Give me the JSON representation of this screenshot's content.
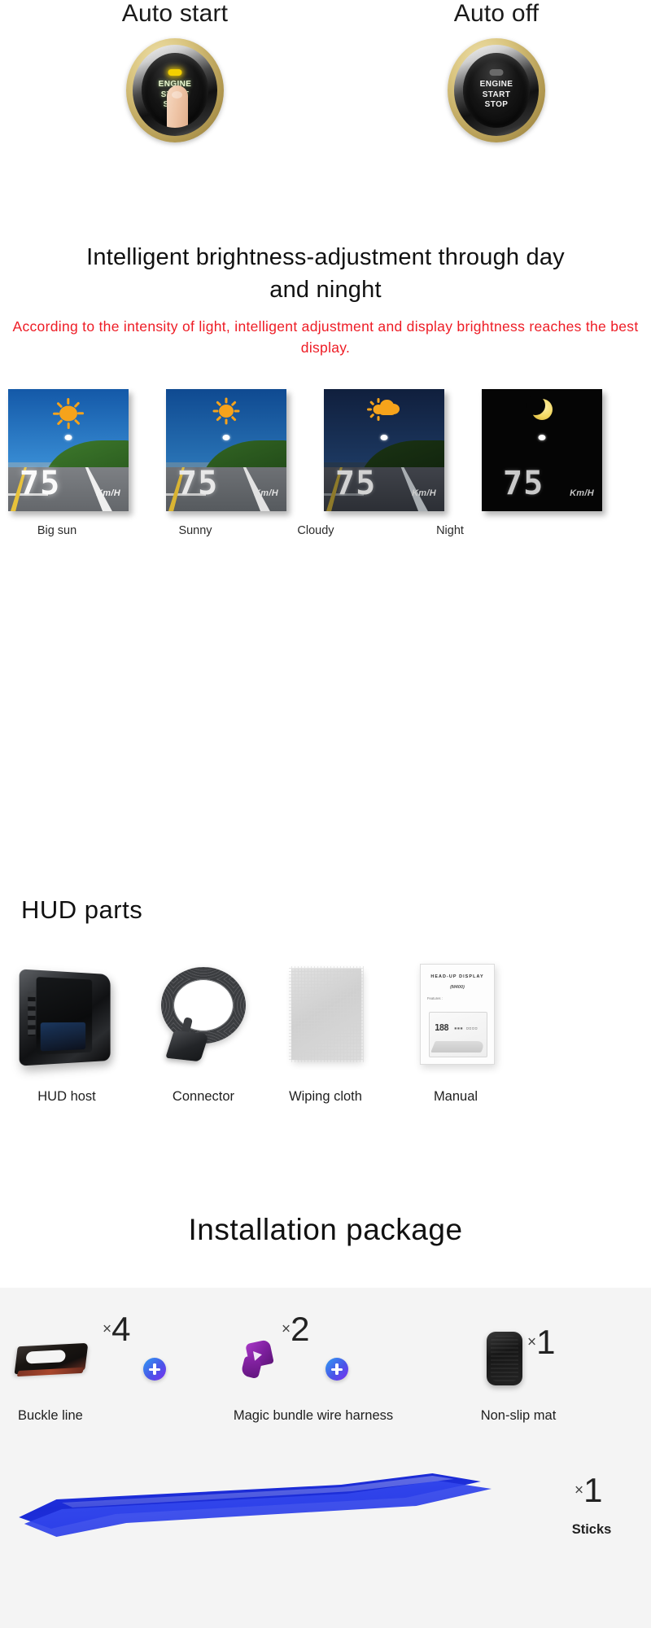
{
  "engine_section": {
    "buttons": [
      {
        "title": "Auto start",
        "button_text": "ENGINE\nSTART\nSTOP",
        "line1": "ENGINE",
        "line2": "START",
        "line3": "STOP",
        "led": "on",
        "led_color": "#f4d000",
        "has_finger": true
      },
      {
        "title": "Auto off",
        "button_text": "ENGINE\nSTART\nSTOP",
        "line1": "ENGINE",
        "line2": "START",
        "line3": "STOP",
        "led": "off",
        "led_color": "#6a6a6a",
        "has_finger": false
      }
    ]
  },
  "brightness_section": {
    "heading": "Intelligent brightness-adjustment through day and ninght",
    "subheading": "According to the intensity of light, intelligent adjustment and display brightness reaches the best display.",
    "subheading_color": "#ee1c25",
    "panels": [
      {
        "label": "Big sun",
        "weather_icon": "sun-icon",
        "speed": "75",
        "unit": "Km/H",
        "sky_color": "#1a6fc4",
        "brightness": "bright"
      },
      {
        "label": "Sunny",
        "weather_icon": "sun-icon",
        "speed": "75",
        "unit": "Km/H",
        "sky_color": "#17568f",
        "brightness": "medium-bright"
      },
      {
        "label": "Cloudy",
        "weather_icon": "sun-behind-cloud-icon",
        "speed": "75",
        "unit": "Km/H",
        "sky_color": "#16294a",
        "brightness": "dim"
      },
      {
        "label": "Night",
        "weather_icon": "crescent-moon-icon",
        "speed": "75",
        "unit": "Km/H",
        "sky_color": "#050505",
        "brightness": "dark"
      }
    ]
  },
  "parts_section": {
    "heading": "HUD parts",
    "items": [
      {
        "label": "HUD host",
        "icon": "hud-device-icon"
      },
      {
        "label": "Connector",
        "icon": "obd-cable-icon"
      },
      {
        "label": "Wiping cloth",
        "icon": "cloth-icon"
      },
      {
        "label": "Manual",
        "icon": "manual-icon"
      }
    ],
    "manual": {
      "title": "HEAD-UP DISPLAY",
      "model": "(M400)",
      "features_label": "Features :",
      "display_digits": "188"
    }
  },
  "install_section": {
    "heading": "Installation package",
    "band_color": "#f4f4f4",
    "items": [
      {
        "label": "Buckle line",
        "qty_x": "×",
        "qty": "4",
        "icon": "buckle-line-icon",
        "has_plus": true
      },
      {
        "label": "Magic bundle wire harness",
        "qty_x": "×",
        "qty": "2",
        "icon": "velcro-strap-icon",
        "has_plus": true
      },
      {
        "label": "Non-slip mat",
        "qty_x": "×",
        "qty": "1",
        "icon": "non-slip-mat-icon",
        "has_plus": false
      }
    ],
    "sticks": {
      "label": "Sticks",
      "qty_x": "×",
      "qty": "1",
      "icon": "pry-tool-icon",
      "color": "#2236e0"
    }
  }
}
